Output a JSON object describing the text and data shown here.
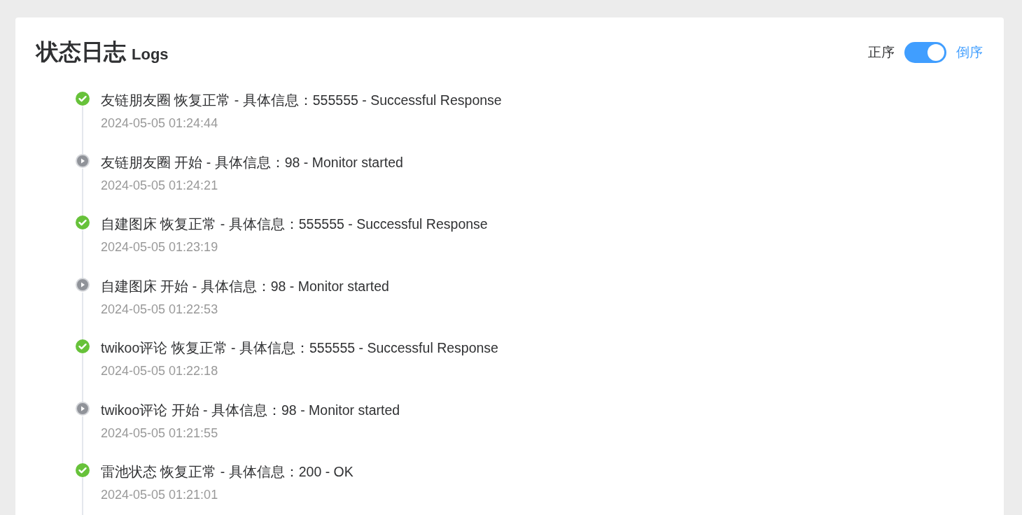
{
  "header": {
    "title": "状态日志",
    "subtitle": "Logs"
  },
  "order_toggle": {
    "left_label": "正序",
    "right_label": "倒序",
    "on": true
  },
  "logs": [
    {
      "kind": "up",
      "message": "友链朋友圈 恢复正常 - 具体信息：555555 - Successful Response",
      "time": "2024-05-05 01:24:44"
    },
    {
      "kind": "start",
      "message": "友链朋友圈 开始 - 具体信息：98 - Monitor started",
      "time": "2024-05-05 01:24:21"
    },
    {
      "kind": "up",
      "message": "自建图床 恢复正常 - 具体信息：555555 - Successful Response",
      "time": "2024-05-05 01:23:19"
    },
    {
      "kind": "start",
      "message": "自建图床 开始 - 具体信息：98 - Monitor started",
      "time": "2024-05-05 01:22:53"
    },
    {
      "kind": "up",
      "message": "twikoo评论 恢复正常 - 具体信息：555555 - Successful Response",
      "time": "2024-05-05 01:22:18"
    },
    {
      "kind": "start",
      "message": "twikoo评论 开始 - 具体信息：98 - Monitor started",
      "time": "2024-05-05 01:21:55"
    },
    {
      "kind": "up",
      "message": "雷池状态 恢复正常 - 具体信息：200 - OK",
      "time": "2024-05-05 01:21:01"
    }
  ]
}
